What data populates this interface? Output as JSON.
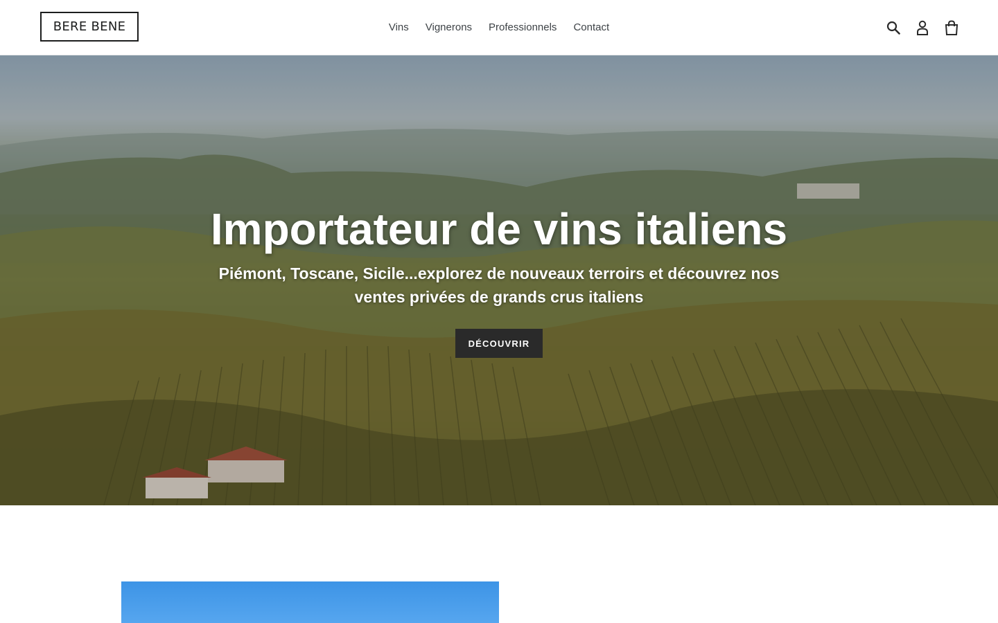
{
  "header": {
    "logo": "BERE BENE",
    "nav": [
      "Vins",
      "Vignerons",
      "Professionnels",
      "Contact"
    ],
    "icons": [
      "search-icon",
      "account-icon",
      "cart-icon"
    ]
  },
  "hero": {
    "title": "Importateur de vins italiens",
    "subtitle": "Piémont, Toscane, Sicile...explorez de nouveaux terroirs et découvrez nos ventes privées de grands crus italiens",
    "button_label": "DÉCOUVRIR"
  },
  "colors": {
    "button_bg": "#2a2a2a",
    "text": "#3d4246",
    "sky": "#4a9ce9"
  }
}
